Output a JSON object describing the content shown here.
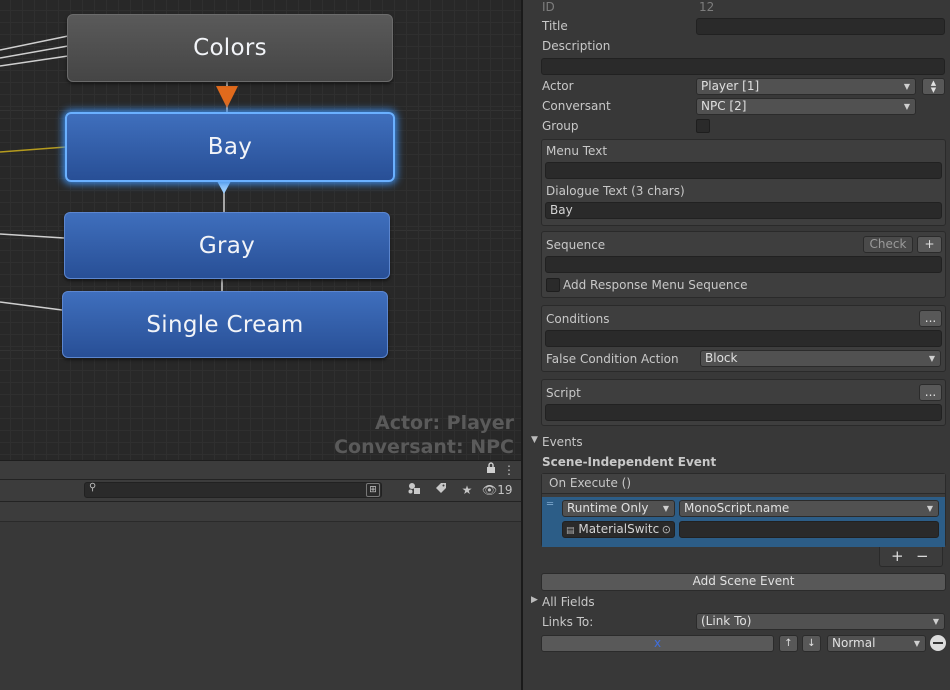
{
  "graph": {
    "nodes": {
      "colors": "Colors",
      "bay": "Bay",
      "gray": "Gray",
      "single_cream": "Single Cream"
    },
    "overlay_actor": "Actor: Player",
    "overlay_conversant": "Conversant: NPC"
  },
  "lower_panel": {
    "hidden_count": "19"
  },
  "inspector": {
    "id_label": "ID",
    "id_value": "12",
    "title_label": "Title",
    "title_value": "",
    "description_label": "Description",
    "description_value": "",
    "actor_label": "Actor",
    "actor_value": "Player [1]",
    "conversant_label": "Conversant",
    "conversant_value": "NPC [2]",
    "group_label": "Group",
    "menu_text_label": "Menu Text",
    "menu_text_value": "",
    "dialogue_text_label": "Dialogue Text (3 chars)",
    "dialogue_text_value": "Bay",
    "sequence_label": "Sequence",
    "check_button": "Check",
    "plus_button": "+",
    "sequence_value": "",
    "add_response_menu_sequence": "Add Response Menu Sequence",
    "conditions_label": "Conditions",
    "ellipsis_button": "...",
    "conditions_value": "",
    "false_condition_label": "False Condition Action",
    "false_condition_value": "Block",
    "script_label": "Script",
    "script_value": "",
    "events_label": "Events",
    "scene_independent_label": "Scene-Independent Event",
    "on_execute_label": "On Execute ()",
    "runtime_value": "Runtime Only",
    "function_value": "MonoScript.name",
    "object_value": "MaterialSwitc",
    "argument_value": "",
    "add_listener": "+",
    "remove_listener": "−",
    "add_scene_event": "Add Scene Event",
    "all_fields_label": "All Fields",
    "links_to_label": "Links To:",
    "links_to_value": "(Link To)",
    "link_x": "x",
    "link_priority": "Normal"
  }
}
